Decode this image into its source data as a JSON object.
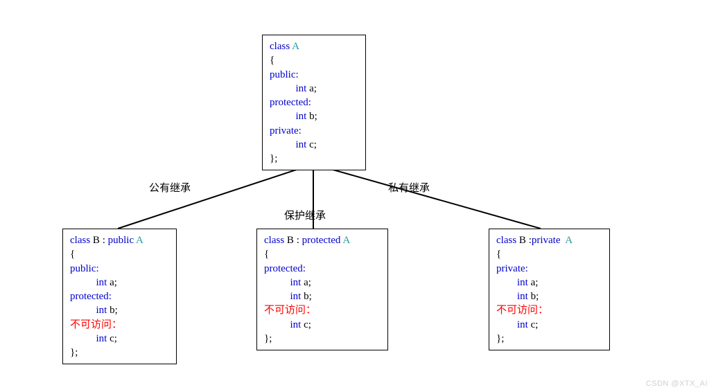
{
  "classA": {
    "l1_kw": "class ",
    "l1_name": "A",
    "l2": "{",
    "l3": "public:",
    "l4": "          int ",
    "l4v": "a;",
    "l5": "protected:",
    "l6": "          int ",
    "l6v": "b;",
    "l7": "private:",
    "l8": "          int ",
    "l8v": "c;",
    "l9": "};"
  },
  "labels": {
    "left": "公有继承",
    "mid": "保护继承",
    "right": "私有继承"
  },
  "boxPublic": {
    "h_kw1": "class ",
    "h_b": "B",
    "h_sep": " : ",
    "h_kw2": "public ",
    "h_a": "A",
    "l2": "{",
    "l3": "public:",
    "l4": "          int ",
    "l4v": "a;",
    "l5": "protected:",
    "l6": "          int ",
    "l6v": "b;",
    "l7": "不可访问：",
    "l8": "          int ",
    "l8v": "c;",
    "l9": "};"
  },
  "boxProtected": {
    "h_kw1": "class ",
    "h_b": "B",
    "h_sep": " : ",
    "h_kw2": "protected ",
    "h_a": "A",
    "l2": "{",
    "l3": "protected:",
    "l4": "          int ",
    "l4v": "a;",
    "l5": "          int ",
    "l5v": "b;",
    "l6": "不可访问：",
    "l7": "          int ",
    "l7v": "c;",
    "l8": "};"
  },
  "boxPrivate": {
    "h_kw1": "class ",
    "h_b": "B",
    "h_sep": " :",
    "h_kw2": "private  ",
    "h_a": "A",
    "l2": "{",
    "l3": "private:",
    "l4": "        int ",
    "l4v": "a;",
    "l5": "        int ",
    "l5v": "b;",
    "l6": "不可访问：",
    "l7": "        int ",
    "l7v": "c;",
    "l8": "};"
  },
  "watermark": "CSDN @XTX_AI"
}
